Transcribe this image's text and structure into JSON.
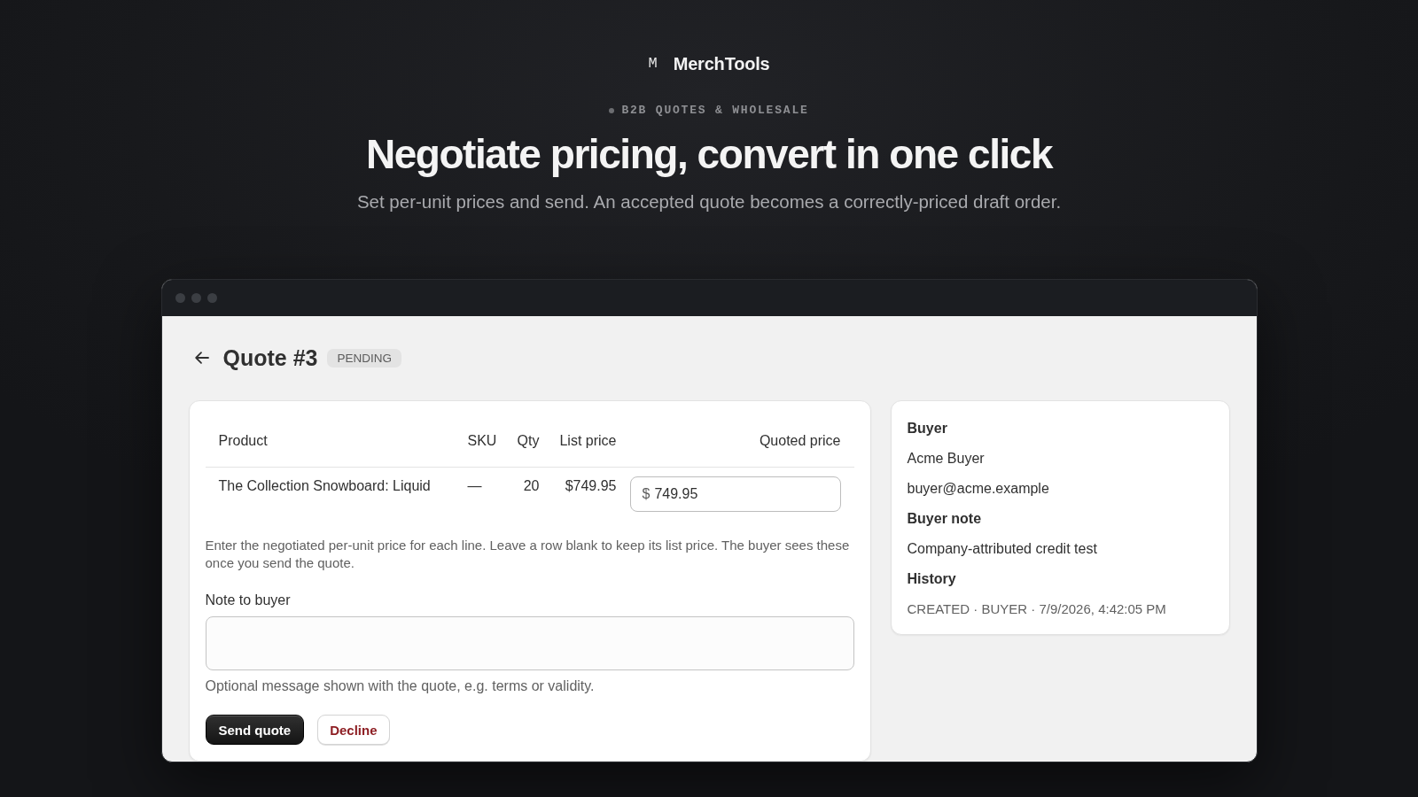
{
  "brand": {
    "mark": "M",
    "name": "MerchTools"
  },
  "hero": {
    "eyebrow": "B2B QUOTES & WHOLESALE",
    "title": "Negotiate pricing, convert in one click",
    "subtitle": "Set per-unit prices and send. An accepted quote becomes a correctly-priced draft order."
  },
  "window": {
    "page_header": {
      "title": "Quote #3",
      "status": "PENDING"
    },
    "line_items": {
      "columns": [
        "Product",
        "SKU",
        "Qty",
        "List price",
        "Quoted price"
      ],
      "rows": [
        {
          "product": "The Collection Snowboard: Liquid",
          "sku": "—",
          "qty": "20",
          "list_price": "$749.95",
          "quoted_price": {
            "prefix": "$",
            "value": "749.95"
          }
        }
      ]
    },
    "help_text": "Enter the negotiated per-unit price for each line. Leave a row blank to keep its list price. The buyer sees these once you send the quote.",
    "note_field": {
      "label": "Note to buyer",
      "help": "Optional message shown with the quote, e.g. terms or validity."
    },
    "actions": [
      {
        "label": "Send quote",
        "kind": "primary"
      },
      {
        "label": "Decline",
        "kind": "destructive"
      }
    ],
    "sidebar": {
      "sections": [
        {
          "heading": "Buyer",
          "lines": [
            {
              "text": "Acme Buyer",
              "kind": "detail"
            },
            {
              "text": "buyer@acme.example",
              "kind": "detail"
            }
          ]
        },
        {
          "heading": "Buyer note",
          "lines": [
            {
              "text": "Company-attributed credit test",
              "kind": "detail"
            }
          ]
        },
        {
          "heading": "History",
          "lines": [
            {
              "text": "CREATED · BUYER · 7/9/2026, 4:42:05 PM",
              "kind": "event"
            }
          ]
        }
      ]
    }
  }
}
